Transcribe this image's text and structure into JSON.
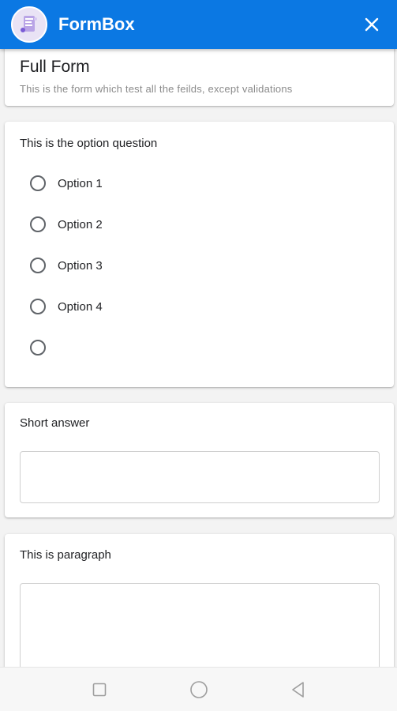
{
  "app": {
    "title": "FormBox"
  },
  "form": {
    "title": "Full Form",
    "description": "This is the form which test all the feilds, except validations"
  },
  "questions": {
    "option": {
      "label": "This is the option question",
      "options": [
        "Option 1",
        "Option 2",
        "Option 3",
        "Option 4",
        ""
      ]
    },
    "short": {
      "label": "Short answer",
      "value": ""
    },
    "paragraph": {
      "label": "This is paragraph",
      "value": ""
    }
  },
  "colors": {
    "accent": "#0b78e3",
    "background": "#f3f3f3"
  },
  "icons": {
    "logo": "formbox-logo-icon",
    "close": "close-icon",
    "nav_recent": "square-icon",
    "nav_home": "circle-icon",
    "nav_back": "triangle-back-icon"
  }
}
